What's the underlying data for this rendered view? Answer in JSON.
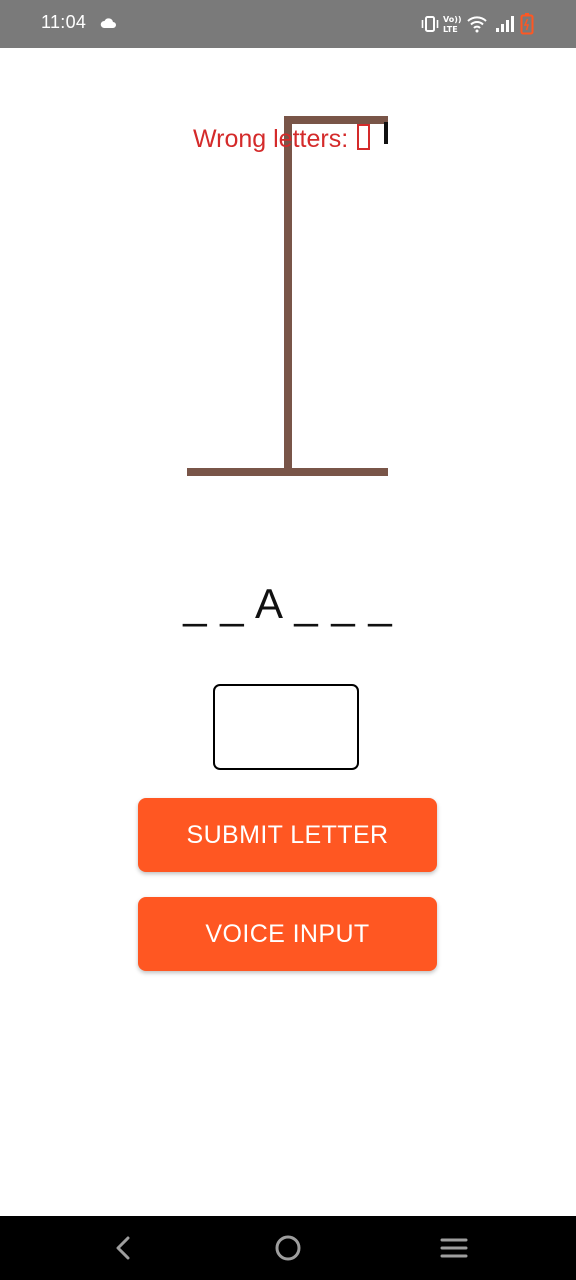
{
  "status_bar": {
    "time": "11:04",
    "icons": [
      "cloud-icon",
      "vibrate-icon",
      "volte-icon",
      "wifi-icon",
      "signal-icon",
      "battery-icon"
    ],
    "battery_color": "#ff5722"
  },
  "game": {
    "wrong_letters_label": "Wrong letters: ",
    "word_display": "_ _ A _ _ _",
    "gallows_color": "#795548",
    "wrong_text_color": "#d42a2a"
  },
  "input": {
    "value": "",
    "placeholder": ""
  },
  "buttons": {
    "submit_label": "SUBMIT LETTER",
    "voice_label": "VOICE INPUT",
    "accent": "#ff5722"
  },
  "nav_bar": {
    "icons": [
      "back-icon",
      "home-icon",
      "menu-icon"
    ]
  }
}
